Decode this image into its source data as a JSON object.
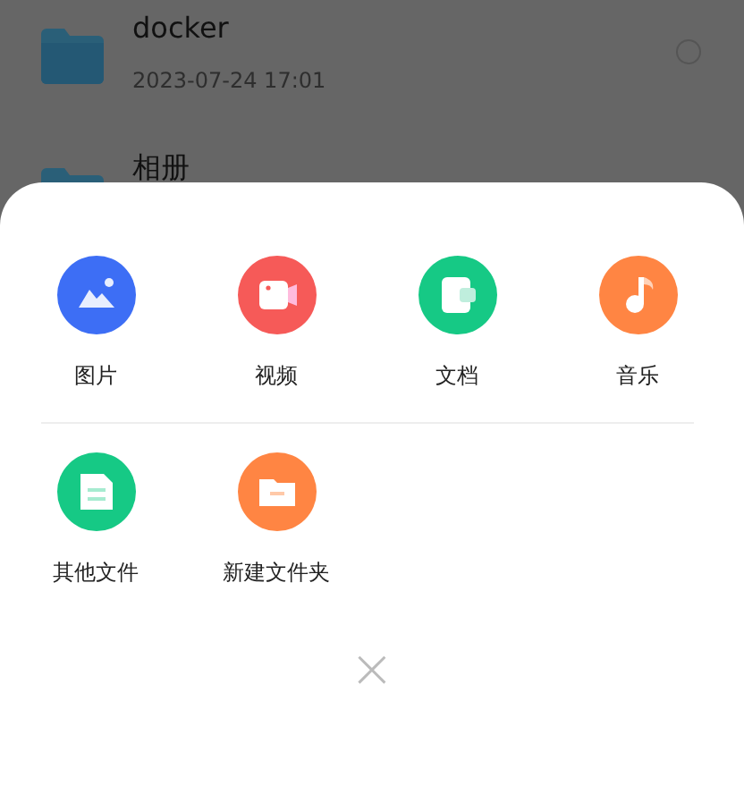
{
  "files": [
    {
      "name": "docker",
      "date": "2023-07-24 17:01",
      "selected": false
    },
    {
      "name": "相册"
    }
  ],
  "sheet": {
    "rows": [
      [
        {
          "label": "图片",
          "kind": "image",
          "color": "#3d6ef5"
        },
        {
          "label": "视频",
          "kind": "video",
          "color": "#f65a58"
        },
        {
          "label": "文档",
          "kind": "document",
          "color": "#16c985"
        },
        {
          "label": "音乐",
          "kind": "music",
          "color": "#ff8543"
        }
      ],
      [
        {
          "label": "其他文件",
          "kind": "file",
          "color": "#16c985"
        },
        {
          "label": "新建文件夹",
          "kind": "folder",
          "color": "#ff8543"
        }
      ]
    ],
    "close": "×"
  }
}
